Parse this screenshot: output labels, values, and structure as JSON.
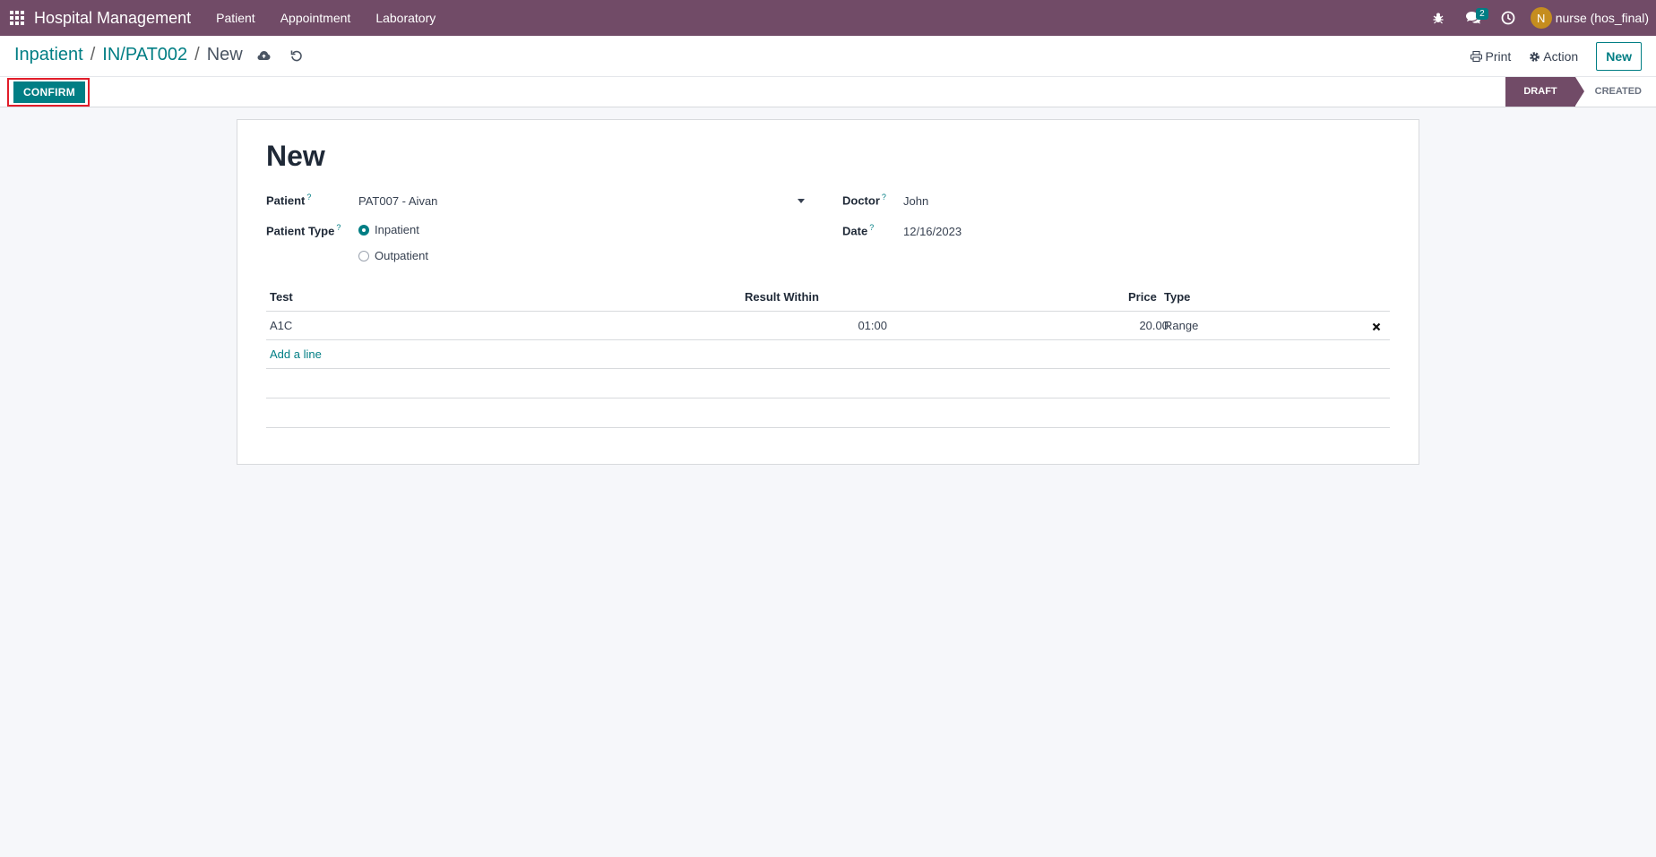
{
  "navbar": {
    "app_name": "Hospital Management",
    "menus": [
      "Patient",
      "Appointment",
      "Laboratory"
    ],
    "messages_count": "2",
    "avatar_initial": "N",
    "user_name": "nurse (hos_final)"
  },
  "breadcrumb": {
    "items": [
      "Inpatient",
      "IN/PAT002"
    ],
    "separator": "/",
    "current": "New"
  },
  "control": {
    "print_label": "Print",
    "action_label": "Action",
    "new_label": "New"
  },
  "statusbar": {
    "confirm_label": "CONFIRM",
    "stages": [
      "DRAFT",
      "CREATED"
    ],
    "active_stage": "DRAFT"
  },
  "form": {
    "title": "New",
    "patient_label": "Patient",
    "patient_value": "PAT007 - Aivan",
    "patient_type_label": "Patient Type",
    "patient_type_options": [
      "Inpatient",
      "Outpatient"
    ],
    "patient_type_selected": "Inpatient",
    "doctor_label": "Doctor",
    "doctor_value": "John",
    "date_label": "Date",
    "date_value": "12/16/2023",
    "help_mark": "?"
  },
  "table": {
    "headers": [
      "Test",
      "Result Within",
      "Price",
      "Type"
    ],
    "rows": [
      {
        "test": "A1C",
        "result_within": "01:00",
        "price": "20.00",
        "type": "Range"
      }
    ],
    "add_line_label": "Add a line"
  },
  "colors": {
    "brand": "#714b67",
    "accent": "#017e84",
    "highlight": "#e11d2a"
  }
}
